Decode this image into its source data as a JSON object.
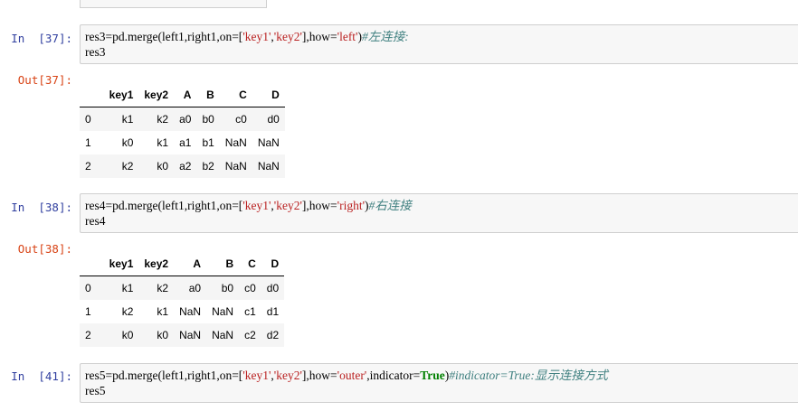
{
  "cells": [
    {
      "in_prompt": "In  [37]:",
      "line1": {
        "pre": "res3=pd.merge(left1,right1,on=[",
        "s1": "'key1'",
        "comma": ",",
        "s2": "'key2'",
        "mid": "],how=",
        "s3": "'left'",
        "post": ")",
        "comment": "#左连接:"
      },
      "line2": "res3",
      "out_prompt": "Out[37]:",
      "columns": [
        "",
        "key1",
        "key2",
        "A",
        "B",
        "C",
        "D"
      ],
      "rows": [
        [
          "0",
          "k1",
          "k2",
          "a0",
          "b0",
          "c0",
          "d0"
        ],
        [
          "1",
          "k0",
          "k1",
          "a1",
          "b1",
          "NaN",
          "NaN"
        ],
        [
          "2",
          "k2",
          "k0",
          "a2",
          "b2",
          "NaN",
          "NaN"
        ]
      ]
    },
    {
      "in_prompt": "In  [38]:",
      "line1": {
        "pre": "res4=pd.merge(left1,right1,on=[",
        "s1": "'key1'",
        "comma": ",",
        "s2": "'key2'",
        "mid": "],how=",
        "s3": "'right'",
        "post": ")",
        "comment": "#右连接"
      },
      "line2": "res4",
      "out_prompt": "Out[38]:",
      "columns": [
        "",
        "key1",
        "key2",
        "A",
        "B",
        "C",
        "D"
      ],
      "rows": [
        [
          "0",
          "k1",
          "k2",
          "a0",
          "b0",
          "c0",
          "d0"
        ],
        [
          "1",
          "k2",
          "k1",
          "NaN",
          "NaN",
          "c1",
          "d1"
        ],
        [
          "2",
          "k0",
          "k0",
          "NaN",
          "NaN",
          "c2",
          "d2"
        ]
      ]
    },
    {
      "in_prompt": "In  [41]:",
      "line1": {
        "pre": "res5=pd.merge(left1,right1,on=[",
        "s1": "'key1'",
        "comma": ",",
        "s2": "'key2'",
        "mid": "],how=",
        "s3": "'outer'",
        "post2": ",indicator=",
        "kw": "True",
        "post": ")",
        "comment": "#indicator=True:显示连接方式"
      },
      "line2": "res5"
    }
  ]
}
